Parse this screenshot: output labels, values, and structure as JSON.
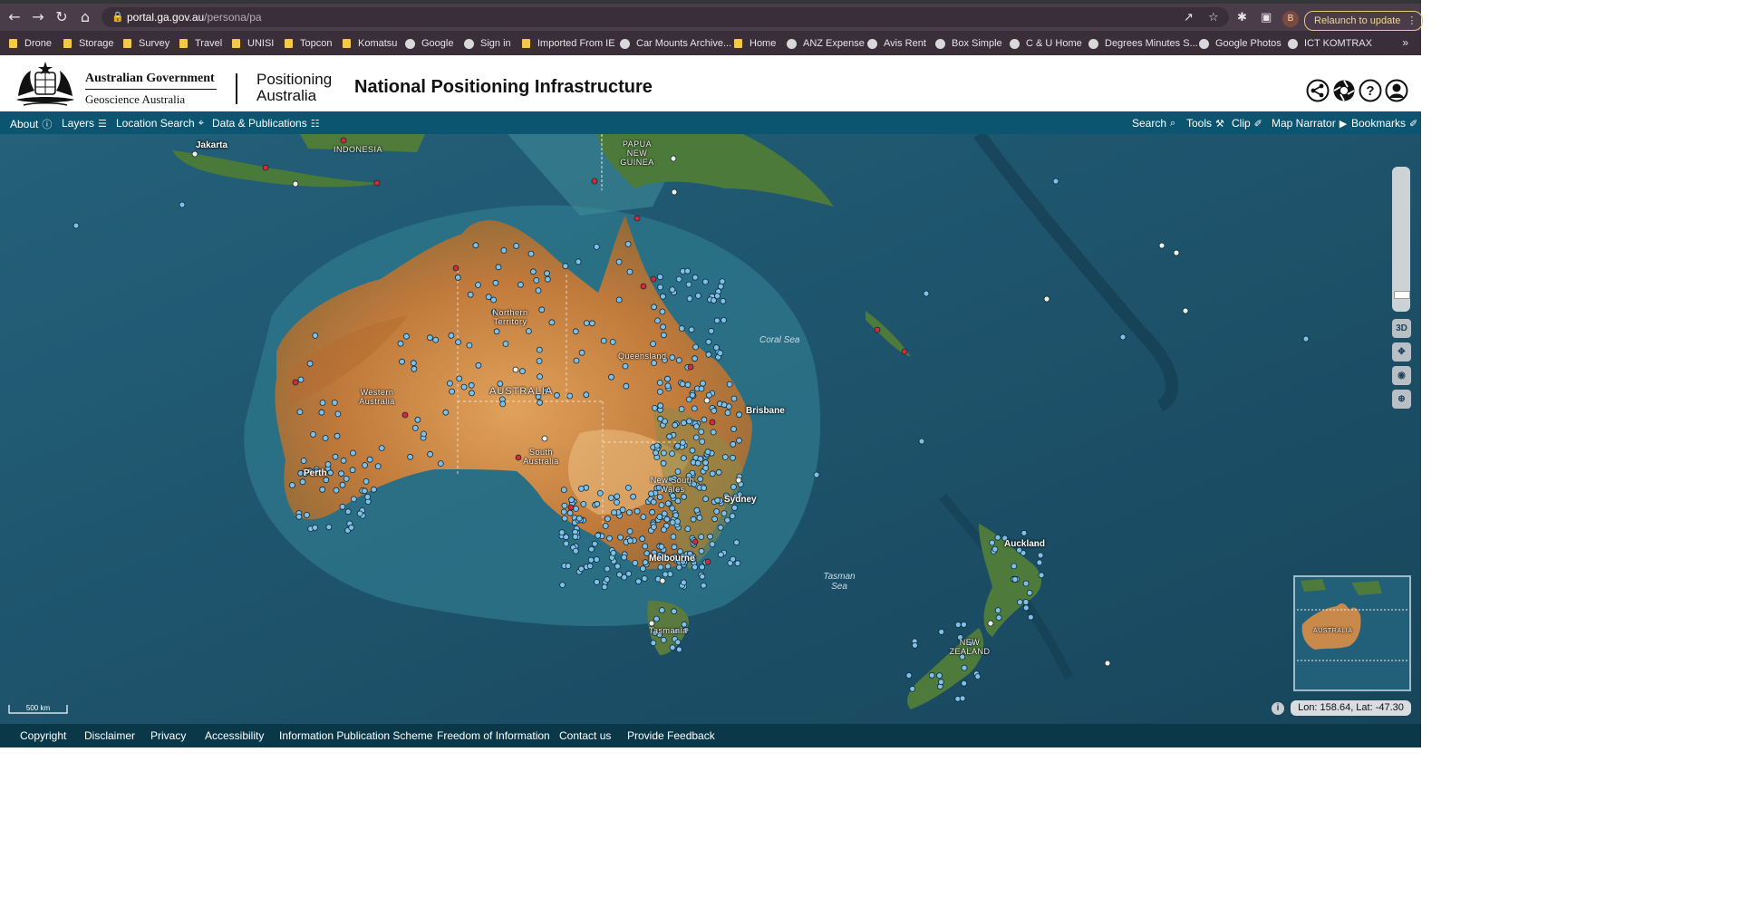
{
  "browser": {
    "url_host": "portal.ga.gov.au",
    "url_path": "/persona/pa",
    "relaunch_label": "Relaunch to update",
    "profile_initial": "B"
  },
  "bookmarks": [
    {
      "label": "Drone",
      "icon": "folder-icon"
    },
    {
      "label": "Storage",
      "icon": "folder-icon"
    },
    {
      "label": "Survey",
      "icon": "folder-icon"
    },
    {
      "label": "Travel",
      "icon": "folder-icon"
    },
    {
      "label": "UNISI",
      "icon": "folder-icon"
    },
    {
      "label": "Topcon",
      "icon": "folder-icon"
    },
    {
      "label": "Komatsu",
      "icon": "folder-icon"
    },
    {
      "label": "Google",
      "icon": "google-icon"
    },
    {
      "label": "Sign in",
      "icon": "globe-icon"
    },
    {
      "label": "Imported From IE",
      "icon": "folder-icon"
    },
    {
      "label": "Car Mounts Archive...",
      "icon": "b-icon"
    },
    {
      "label": "Home",
      "icon": "folder-icon"
    },
    {
      "label": "ANZ Expense",
      "icon": "globe-icon"
    },
    {
      "label": "Avis Rent",
      "icon": "avis-icon"
    },
    {
      "label": "Box Simple",
      "icon": "box-icon"
    },
    {
      "label": "C & U Home",
      "icon": "s-icon"
    },
    {
      "label": "Degrees Minutes S...",
      "icon": "fcc-icon"
    },
    {
      "label": "Google Photos",
      "icon": "photos-icon"
    },
    {
      "label": "ICT KOMTRAX",
      "icon": "globe-icon"
    }
  ],
  "header": {
    "gov_line1": "Australian Government",
    "gov_line2": "Geoscience Australia",
    "brand": "Positioning Australia",
    "title": "National Positioning Infrastructure"
  },
  "menu_left": [
    {
      "label": "About",
      "icon": "info-icon"
    },
    {
      "label": "Layers",
      "icon": "layers-icon"
    },
    {
      "label": "Location Search",
      "icon": "pin-icon"
    },
    {
      "label": "Data & Publications",
      "icon": "document-icon"
    }
  ],
  "menu_right": [
    {
      "label": "Search",
      "icon": "search-icon"
    },
    {
      "label": "Tools",
      "icon": "wrench-icon"
    },
    {
      "label": "Clip",
      "icon": "paperclip-icon"
    },
    {
      "label": "Map Narrator",
      "icon": "play-icon"
    },
    {
      "label": "Bookmarks",
      "icon": "bookmark-icon"
    }
  ],
  "map": {
    "region_labels": {
      "indonesia": "INDONESIA",
      "png": "PAPUA NEW GUINEA",
      "nt": "Northern Territory",
      "qld": "Queensland",
      "wa": "Western Australia",
      "australia": "AUSTRALIA",
      "sa": "South Australia",
      "nsw": "New South Wales",
      "tas": "Tasmania",
      "nz": "NEW ZEALAND"
    },
    "cities": {
      "jakarta": "Jakarta",
      "brisbane": "Brisbane",
      "perth": "Perth",
      "sydney": "Sydney",
      "melbourne": "Melbourne",
      "auckland": "Auckland"
    },
    "seas": {
      "coral": "Coral Sea",
      "tasman": "Tasman Sea"
    },
    "scale_label": "500 km",
    "view_3d_label": "3D",
    "overview_label": "AUSTRALIA",
    "coordinates": "Lon: 158.64, Lat: -47.30",
    "colors": {
      "station_blue": "#7fc0e8",
      "station_red": "#d62839",
      "station_white": "#f4efe4"
    }
  },
  "footer": [
    "Copyright",
    "Disclaimer",
    "Privacy",
    "Accessibility",
    "Information Publication Scheme",
    "Freedom of Information",
    "Contact us",
    "Provide Feedback"
  ]
}
